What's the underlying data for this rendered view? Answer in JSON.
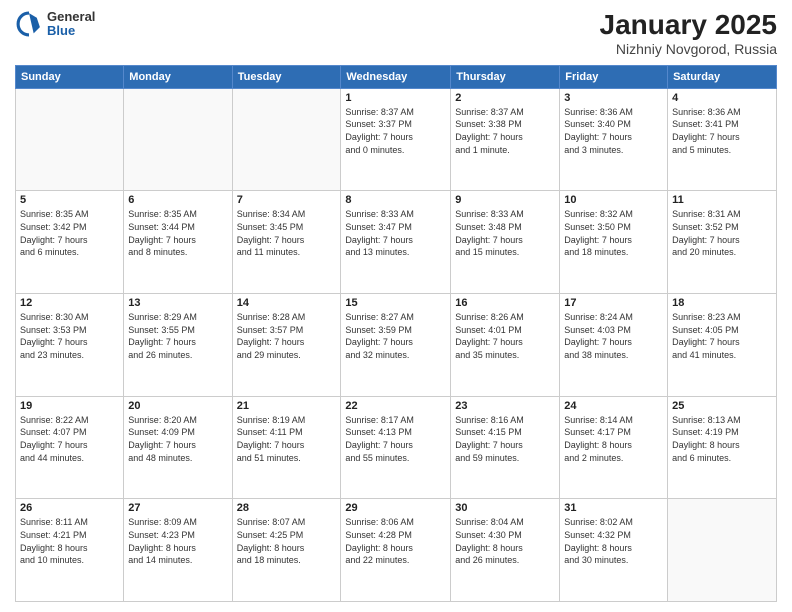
{
  "header": {
    "logo": {
      "general": "General",
      "blue": "Blue"
    },
    "title": "January 2025",
    "subtitle": "Nizhniy Novgorod, Russia"
  },
  "weekdays": [
    "Sunday",
    "Monday",
    "Tuesday",
    "Wednesday",
    "Thursday",
    "Friday",
    "Saturday"
  ],
  "weeks": [
    [
      {
        "day": "",
        "info": ""
      },
      {
        "day": "",
        "info": ""
      },
      {
        "day": "",
        "info": ""
      },
      {
        "day": "1",
        "info": "Sunrise: 8:37 AM\nSunset: 3:37 PM\nDaylight: 7 hours\nand 0 minutes."
      },
      {
        "day": "2",
        "info": "Sunrise: 8:37 AM\nSunset: 3:38 PM\nDaylight: 7 hours\nand 1 minute."
      },
      {
        "day": "3",
        "info": "Sunrise: 8:36 AM\nSunset: 3:40 PM\nDaylight: 7 hours\nand 3 minutes."
      },
      {
        "day": "4",
        "info": "Sunrise: 8:36 AM\nSunset: 3:41 PM\nDaylight: 7 hours\nand 5 minutes."
      }
    ],
    [
      {
        "day": "5",
        "info": "Sunrise: 8:35 AM\nSunset: 3:42 PM\nDaylight: 7 hours\nand 6 minutes."
      },
      {
        "day": "6",
        "info": "Sunrise: 8:35 AM\nSunset: 3:44 PM\nDaylight: 7 hours\nand 8 minutes."
      },
      {
        "day": "7",
        "info": "Sunrise: 8:34 AM\nSunset: 3:45 PM\nDaylight: 7 hours\nand 11 minutes."
      },
      {
        "day": "8",
        "info": "Sunrise: 8:33 AM\nSunset: 3:47 PM\nDaylight: 7 hours\nand 13 minutes."
      },
      {
        "day": "9",
        "info": "Sunrise: 8:33 AM\nSunset: 3:48 PM\nDaylight: 7 hours\nand 15 minutes."
      },
      {
        "day": "10",
        "info": "Sunrise: 8:32 AM\nSunset: 3:50 PM\nDaylight: 7 hours\nand 18 minutes."
      },
      {
        "day": "11",
        "info": "Sunrise: 8:31 AM\nSunset: 3:52 PM\nDaylight: 7 hours\nand 20 minutes."
      }
    ],
    [
      {
        "day": "12",
        "info": "Sunrise: 8:30 AM\nSunset: 3:53 PM\nDaylight: 7 hours\nand 23 minutes."
      },
      {
        "day": "13",
        "info": "Sunrise: 8:29 AM\nSunset: 3:55 PM\nDaylight: 7 hours\nand 26 minutes."
      },
      {
        "day": "14",
        "info": "Sunrise: 8:28 AM\nSunset: 3:57 PM\nDaylight: 7 hours\nand 29 minutes."
      },
      {
        "day": "15",
        "info": "Sunrise: 8:27 AM\nSunset: 3:59 PM\nDaylight: 7 hours\nand 32 minutes."
      },
      {
        "day": "16",
        "info": "Sunrise: 8:26 AM\nSunset: 4:01 PM\nDaylight: 7 hours\nand 35 minutes."
      },
      {
        "day": "17",
        "info": "Sunrise: 8:24 AM\nSunset: 4:03 PM\nDaylight: 7 hours\nand 38 minutes."
      },
      {
        "day": "18",
        "info": "Sunrise: 8:23 AM\nSunset: 4:05 PM\nDaylight: 7 hours\nand 41 minutes."
      }
    ],
    [
      {
        "day": "19",
        "info": "Sunrise: 8:22 AM\nSunset: 4:07 PM\nDaylight: 7 hours\nand 44 minutes."
      },
      {
        "day": "20",
        "info": "Sunrise: 8:20 AM\nSunset: 4:09 PM\nDaylight: 7 hours\nand 48 minutes."
      },
      {
        "day": "21",
        "info": "Sunrise: 8:19 AM\nSunset: 4:11 PM\nDaylight: 7 hours\nand 51 minutes."
      },
      {
        "day": "22",
        "info": "Sunrise: 8:17 AM\nSunset: 4:13 PM\nDaylight: 7 hours\nand 55 minutes."
      },
      {
        "day": "23",
        "info": "Sunrise: 8:16 AM\nSunset: 4:15 PM\nDaylight: 7 hours\nand 59 minutes."
      },
      {
        "day": "24",
        "info": "Sunrise: 8:14 AM\nSunset: 4:17 PM\nDaylight: 8 hours\nand 2 minutes."
      },
      {
        "day": "25",
        "info": "Sunrise: 8:13 AM\nSunset: 4:19 PM\nDaylight: 8 hours\nand 6 minutes."
      }
    ],
    [
      {
        "day": "26",
        "info": "Sunrise: 8:11 AM\nSunset: 4:21 PM\nDaylight: 8 hours\nand 10 minutes."
      },
      {
        "day": "27",
        "info": "Sunrise: 8:09 AM\nSunset: 4:23 PM\nDaylight: 8 hours\nand 14 minutes."
      },
      {
        "day": "28",
        "info": "Sunrise: 8:07 AM\nSunset: 4:25 PM\nDaylight: 8 hours\nand 18 minutes."
      },
      {
        "day": "29",
        "info": "Sunrise: 8:06 AM\nSunset: 4:28 PM\nDaylight: 8 hours\nand 22 minutes."
      },
      {
        "day": "30",
        "info": "Sunrise: 8:04 AM\nSunset: 4:30 PM\nDaylight: 8 hours\nand 26 minutes."
      },
      {
        "day": "31",
        "info": "Sunrise: 8:02 AM\nSunset: 4:32 PM\nDaylight: 8 hours\nand 30 minutes."
      },
      {
        "day": "",
        "info": ""
      }
    ]
  ]
}
